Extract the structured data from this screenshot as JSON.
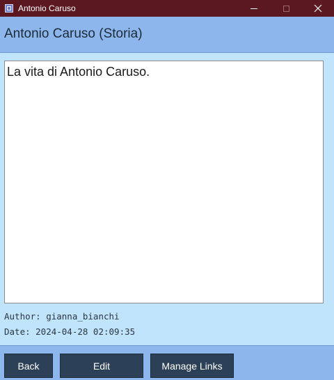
{
  "window": {
    "title": "Antonio Caruso",
    "icon": "app-icon",
    "controls": [
      "minimize-icon",
      "maximize-icon",
      "close-icon"
    ]
  },
  "header": {
    "title": "Antonio Caruso (Storia)"
  },
  "content": {
    "text": "La vita di Antonio Caruso."
  },
  "meta": {
    "author": "Author: gianna_bianchi",
    "date": "Date: 2024-04-28 02:09:35"
  },
  "footer": {
    "back_label": "Back",
    "edit_label": "Edit",
    "manage_links_label": "Manage Links"
  },
  "colors": {
    "titlebar": "#5c1820",
    "header": "#8cb6ec",
    "background": "#bfe4fb",
    "button": "#2c4158"
  }
}
